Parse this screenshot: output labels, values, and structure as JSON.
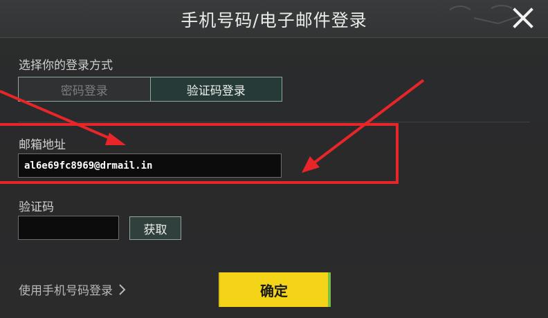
{
  "dialog": {
    "title": "手机号码/电子邮件登录",
    "close_icon": "close-icon"
  },
  "login_method": {
    "label": "选择你的登录方式",
    "options": [
      {
        "label": "密码登录",
        "selected": false
      },
      {
        "label": "验证码登录",
        "selected": true
      }
    ]
  },
  "email": {
    "label": "邮箱地址",
    "value": "al6e69fc8969@drmail.in",
    "placeholder": ""
  },
  "verification": {
    "label": "验证码",
    "value": "",
    "get_button_label": "获取"
  },
  "footer": {
    "phone_login_link": "使用手机号码登录",
    "confirm_label": "确定"
  },
  "colors": {
    "accent_yellow": "#f3d419",
    "selected_tab": "#263a37",
    "annotation_red": "#e8262a"
  }
}
